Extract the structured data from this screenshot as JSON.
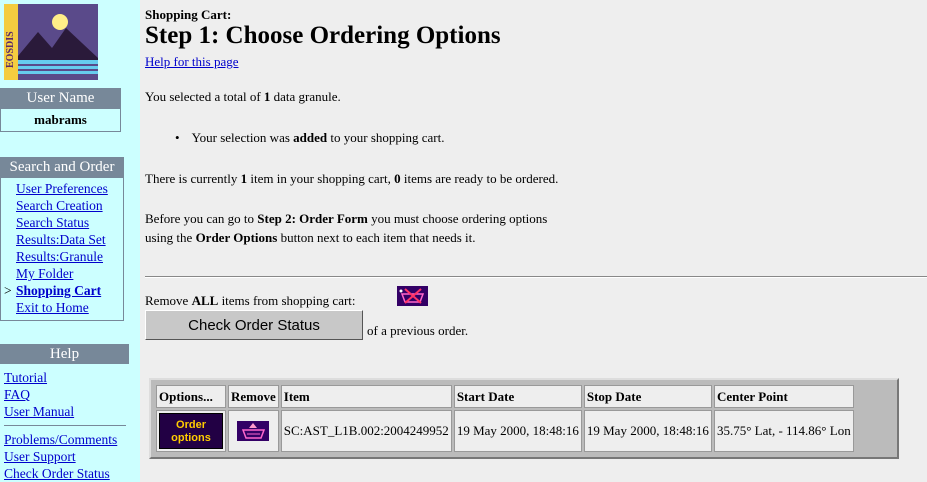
{
  "logo": {
    "text": "EOSDIS"
  },
  "user_panel": {
    "heading": "User Name",
    "value": "mabrams"
  },
  "search_panel": {
    "heading": "Search and Order",
    "current_marker": ">",
    "items": [
      {
        "label": "User Preferences"
      },
      {
        "label": "Search Creation"
      },
      {
        "label": "Search Status"
      },
      {
        "label": "Results:Data Set"
      },
      {
        "label": "Results:Granule"
      },
      {
        "label": "My Folder"
      },
      {
        "label": "Shopping Cart"
      },
      {
        "label": "Exit to Home"
      }
    ]
  },
  "help_panel": {
    "heading": "Help",
    "items": [
      {
        "label": "Tutorial"
      },
      {
        "label": "FAQ"
      },
      {
        "label": "User Manual"
      }
    ],
    "items2": [
      {
        "label": "Problems/Comments"
      },
      {
        "label": "User Support"
      },
      {
        "label": "Check Order Status"
      }
    ]
  },
  "page": {
    "crumb": "Shopping Cart:",
    "title": "Step 1: Choose Ordering Options",
    "help_link": "Help for this page",
    "selected": {
      "pre": "You selected a total of ",
      "count": "1",
      "post": " data granule."
    },
    "bullet": {
      "pre": "Your selection was ",
      "bold": "added",
      "post": " to your shopping cart."
    },
    "cart": {
      "pre": "There is currently ",
      "count": "1",
      "mid": " item in your shopping cart, ",
      "ready": "0",
      "post": " items are ready to be ordered."
    },
    "before": {
      "l1_pre": "Before you can go to ",
      "l1_bold": "Step 2: Order Form",
      "l1_post": " you must choose ordering options",
      "l2_pre": "using the ",
      "l2_bold": "Order Options",
      "l2_post": " button next to each item that needs it."
    },
    "remove_all": {
      "pre": "Remove ",
      "bold": "ALL",
      "post": " items from shopping cart:"
    },
    "check_status_button": "Check Order Status",
    "check_status_suffix": "of a previous order."
  },
  "table": {
    "headers": [
      "Options...",
      "Remove",
      "Item",
      "Start Date",
      "Stop Date",
      "Center Point"
    ],
    "rows": [
      {
        "options_label_1": "Order",
        "options_label_2": "options",
        "item": "SC:AST_L1B.002:2004249952",
        "start": "19 May 2000, 18:48:16",
        "stop": "19 May 2000, 18:48:16",
        "center": "35.75° Lat, - 114.86° Lon"
      }
    ]
  }
}
